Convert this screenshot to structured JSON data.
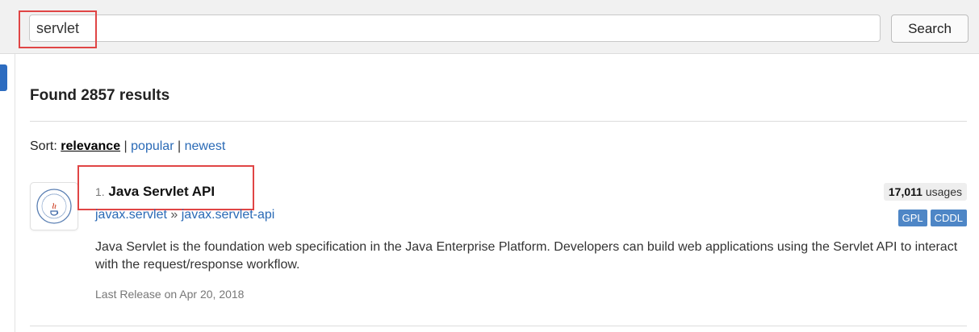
{
  "search": {
    "value": "servlet",
    "button_label": "Search"
  },
  "results": {
    "found_text": "Found 2857 results",
    "sort": {
      "label": "Sort:",
      "options": [
        {
          "label": "relevance",
          "active": true
        },
        {
          "label": "popular",
          "active": false
        },
        {
          "label": "newest",
          "active": false
        }
      ],
      "separator": "|"
    },
    "items": [
      {
        "number": "1.",
        "name": "Java Servlet API",
        "group": "javax.servlet",
        "coord_separator": "»",
        "artifact": "javax.servlet-api",
        "usages_count": "17,011",
        "usages_label": "usages",
        "licenses": [
          "GPL",
          "CDDL"
        ],
        "description": "Java Servlet is the foundation web specification in the Java Enterprise Platform. Developers can build web applications using the Servlet API to interact with the request/response workflow.",
        "last_release": "Last Release on Apr 20, 2018",
        "logo_icon": "java-community-process-logo"
      }
    ]
  },
  "colors": {
    "accent": "#2a6ab6",
    "license_badge": "#4e86c6",
    "annotation": "#e04545"
  }
}
